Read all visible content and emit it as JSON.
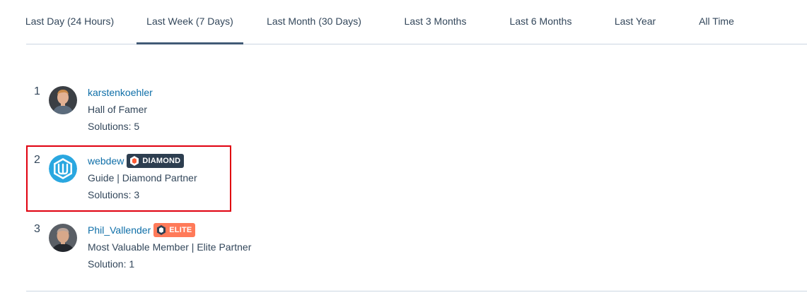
{
  "tabs": [
    {
      "label": "Last Day (24 Hours)",
      "active": false
    },
    {
      "label": "Last Week (7 Days)",
      "active": true
    },
    {
      "label": "Last Month (30 Days)",
      "active": false
    },
    {
      "label": "Last 3 Months",
      "active": false
    },
    {
      "label": "Last 6 Months",
      "active": false
    },
    {
      "label": "Last Year",
      "active": false
    },
    {
      "label": "All Time",
      "active": false
    }
  ],
  "leaders": [
    {
      "rank": "1",
      "username": "karstenkoehler",
      "badge": null,
      "title": "Hall of Famer",
      "solutions": "Solutions: 5",
      "avatar": "person-photo-avatar"
    },
    {
      "rank": "2",
      "username": "webdew",
      "badge": {
        "label": "DIAMOND",
        "color": "#2d3e50"
      },
      "title": "Guide | Diamond Partner",
      "solutions": "Solutions: 3",
      "avatar": "webdew-logo-avatar",
      "highlighted": true
    },
    {
      "rank": "3",
      "username": "Phil_Vallender",
      "badge": {
        "label": "ELITE",
        "color": "#ff7a59"
      },
      "title": "Most Valuable Member | Elite Partner",
      "solutions": "Solution: 1",
      "avatar": "person-photo-avatar"
    }
  ],
  "colors": {
    "link": "#0f6fa8",
    "text": "#33475b",
    "highlight": "#e0000f",
    "rule": "#cbd6e2"
  }
}
